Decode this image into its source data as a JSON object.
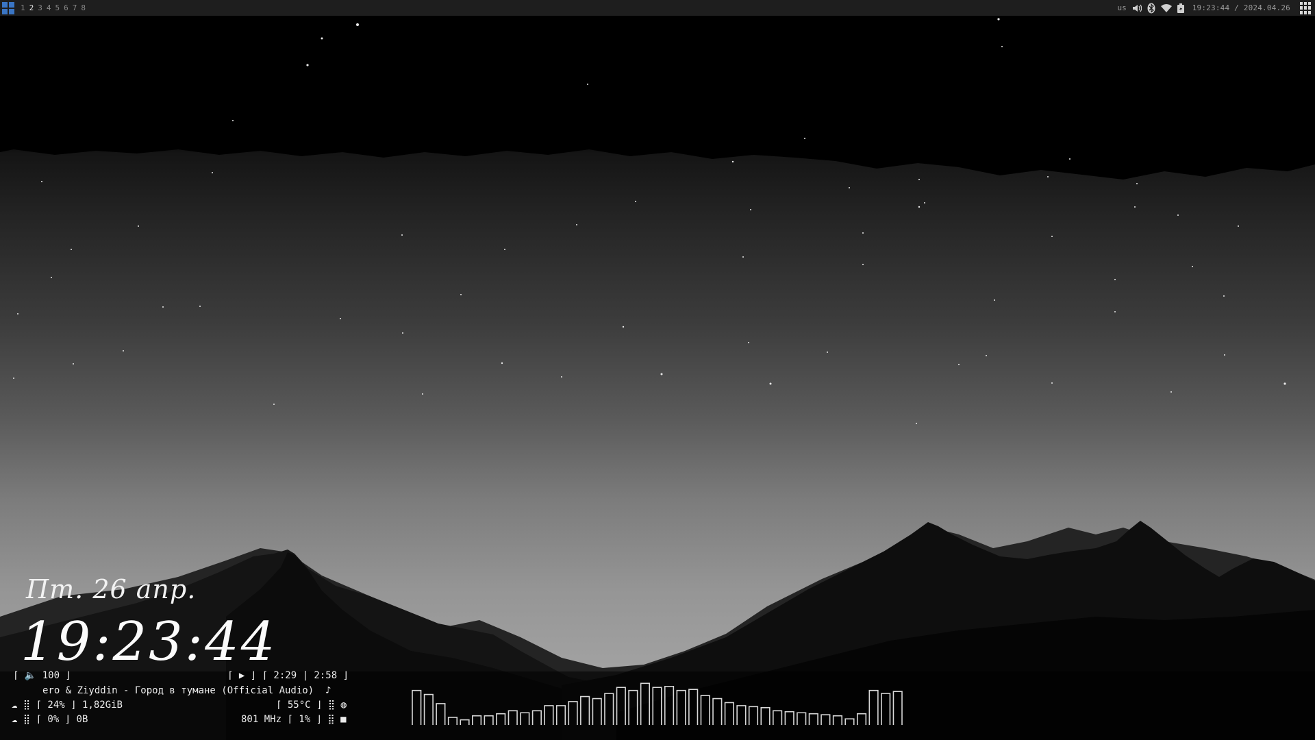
{
  "topbar": {
    "workspaces": [
      "1",
      "2",
      "3",
      "4",
      "5",
      "6",
      "7",
      "8"
    ],
    "active_workspace": "2",
    "keyboard_layout": "us",
    "clock": "19:23:44 / 2024.04.26",
    "icons": [
      "app-launcher-icon",
      "volume-icon",
      "bluetooth-icon",
      "wifi-icon",
      "battery-icon",
      "grid-menu-icon"
    ]
  },
  "clock_widget": {
    "date": "Пт. 26 апр.",
    "time": "19:23:44"
  },
  "player": {
    "volume": "⌈ 🔈 100 ⌋",
    "state": "⌈ ▶ ⌋ ⌈ 2:29 | 2:58 ⌋",
    "track": "ero & Ziyddin - Город в тумане (Official Audio)  ♪"
  },
  "system": {
    "mem": "☁ ⣿ ⌈ 24% ⌋ 1,82GiB",
    "temp": "⌈ 55°C ⌋ ⣿ ◍",
    "swap": "☁ ⣿ ⌈ 0% ⌋ 0B",
    "cpu": "801 MHz ⌈ 1% ⌋ ⣿ ■"
  },
  "visualizer": {
    "levels": [
      0.68,
      0.6,
      0.42,
      0.15,
      0.1,
      0.18,
      0.18,
      0.22,
      0.28,
      0.24,
      0.28,
      0.38,
      0.38,
      0.46,
      0.56,
      0.52,
      0.62,
      0.74,
      0.68,
      0.82,
      0.74,
      0.76,
      0.68,
      0.7,
      0.58,
      0.52,
      0.44,
      0.38,
      0.36,
      0.34,
      0.28,
      0.26,
      0.24,
      0.22,
      0.2,
      0.18,
      0.12,
      0.22,
      0.68,
      0.62,
      0.66
    ]
  }
}
